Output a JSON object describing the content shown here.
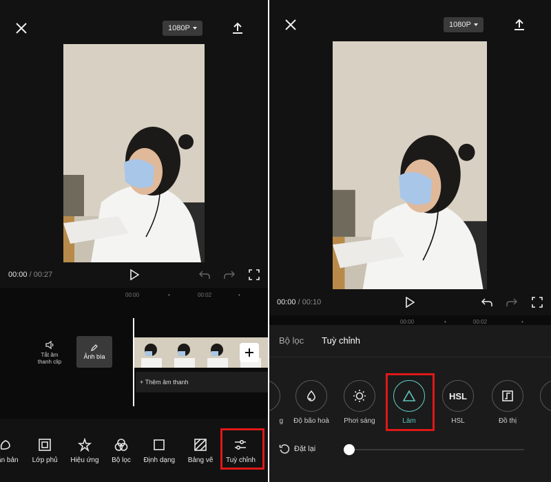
{
  "left": {
    "resolution": "1080P",
    "time_current": "00:00",
    "time_total": "/ 00:27",
    "ruler": [
      "00:00",
      "00:02"
    ],
    "mute_label": "Tắt âm thanh clip",
    "cover_label": "Ảnh bìa",
    "add_audio_label": "+ Thêm âm thanh",
    "toolbar": [
      "Văn bản",
      "Lớp phủ",
      "Hiệu ứng",
      "Bộ lọc",
      "Định dạng",
      "Bảng vẽ",
      "Tuỳ chỉnh"
    ]
  },
  "right": {
    "resolution": "1080P",
    "time_current": "00:00",
    "time_total": "/ 00:10",
    "ruler": [
      "00:00",
      "00:02"
    ],
    "tabs": [
      "Bộ lọc",
      "Tuỳ chỉnh"
    ],
    "adjustments": [
      "g",
      "Độ bão hoà",
      "Phơi sáng",
      "Làm",
      "HSL",
      "Đồ thị"
    ],
    "reset_label": "Đặt lại"
  },
  "colors": {
    "background": "#121212",
    "highlight": "#e01818",
    "accent": "#5ec8c0"
  }
}
